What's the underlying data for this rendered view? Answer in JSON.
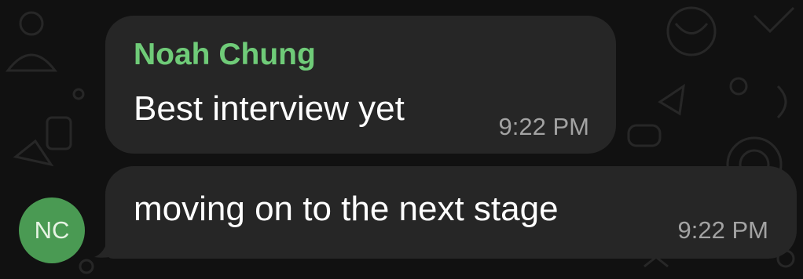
{
  "chat": {
    "contact": {
      "initials": "NC",
      "name": "Noah Chung",
      "avatar_color": "#4a9a53",
      "name_color": "#6fcb78"
    },
    "messages": [
      {
        "sender": "Noah Chung",
        "text": "Best interview yet",
        "time": "9:22 PM"
      },
      {
        "text": "moving on to the next stage",
        "time": "9:22 PM"
      }
    ],
    "bubble_color": "#262626",
    "background_color": "#111111"
  }
}
